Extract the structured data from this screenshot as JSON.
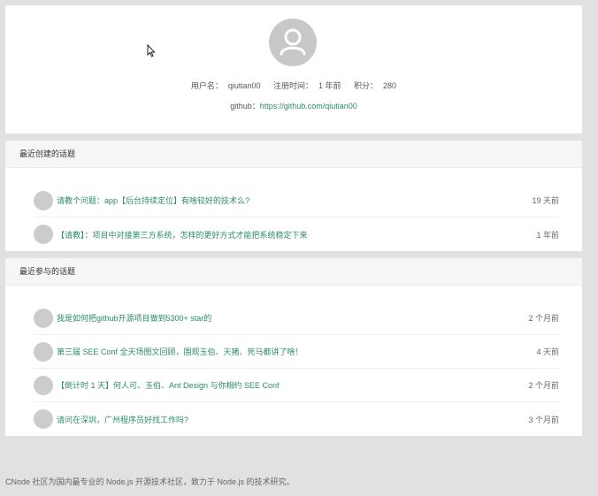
{
  "profile": {
    "username_label": "用户名：",
    "username": "qiutian00",
    "register_label": "注册时间：",
    "register_time": "1 年前",
    "score_label": "积分：",
    "score": "280",
    "github_label": "github：",
    "github_url": "https://github.com/qiutian00"
  },
  "created": {
    "heading": "最近创建的话题",
    "topics": [
      {
        "title": "请教个问题：app【后台持续定位】有啥较好的技术么?",
        "time": "19 天前"
      },
      {
        "title": "【请教】：项目中对接第三方系统，怎样的更好方式才能把系统稳定下来",
        "time": "1 年前"
      }
    ]
  },
  "joined": {
    "heading": "最近参与的话题",
    "topics": [
      {
        "title": "我是如何把github开源项目做到5300+ star的",
        "time": "2 个月前"
      },
      {
        "title": "第三届 SEE Conf 全天场图文回顾，围观玉伯、天猪、死马都讲了啥！",
        "time": "4 天前"
      },
      {
        "title": "【倒计时 1 天】何人可、玉伯、Ant Design 与你相约 SEE Conf",
        "time": "2 个月前"
      },
      {
        "title": "请问在深圳，广州程序员好找工作吗?",
        "time": "3 个月前"
      }
    ]
  },
  "footer": {
    "text": "CNode 社区为国内最专业的 Node.js 开源技术社区，致力于 Node.js 的技术研究。"
  }
}
